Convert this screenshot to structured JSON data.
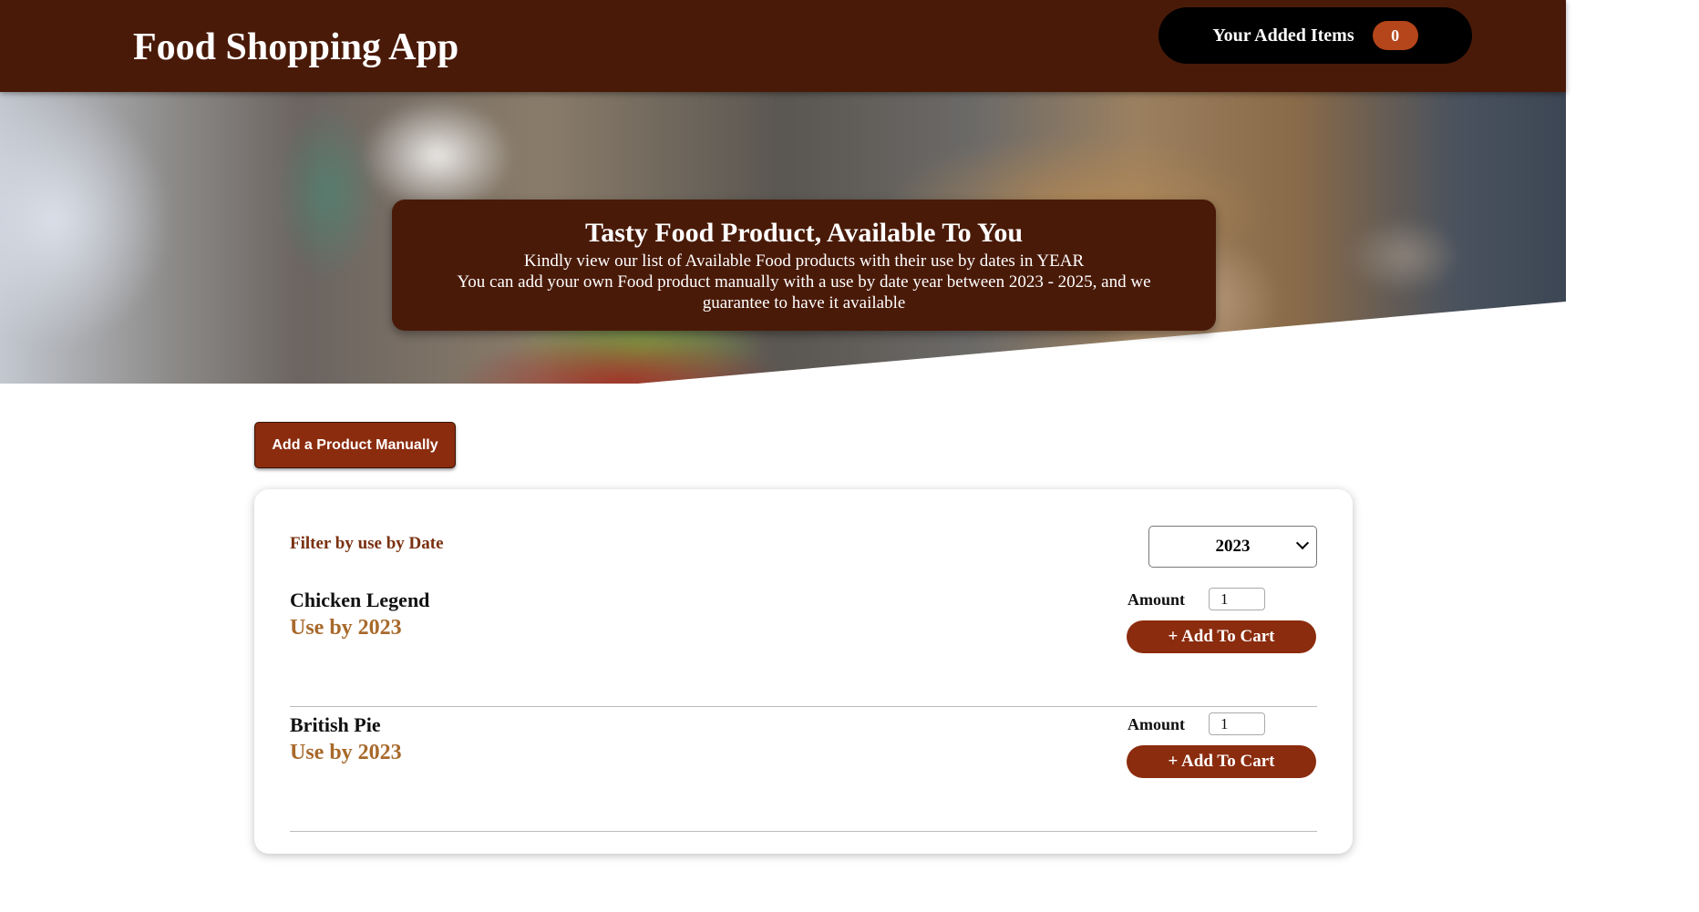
{
  "header": {
    "title": "Food Shopping App",
    "cart_label": "Your Added Items",
    "cart_count": "0"
  },
  "banner": {
    "title": "Tasty Food Product, Available To You",
    "line1": "Kindly view our list of Available Food products with their use by dates in YEAR",
    "line2": "You can add your own Food product manually with a use by date year between 2023 - 2025, and we guarantee to have it available"
  },
  "actions": {
    "add_product_label": "Add a Product Manually"
  },
  "filter": {
    "label": "Filter by use by Date",
    "selected_year": "2023"
  },
  "products": [
    {
      "name": "Chicken Legend",
      "use_by": "Use by 2023",
      "amount_label": "Amount",
      "amount": "1",
      "button_label": "+ Add To Cart"
    },
    {
      "name": "British Pie",
      "use_by": "Use by 2023",
      "amount_label": "Amount",
      "amount": "1",
      "button_label": "+ Add To Cart"
    }
  ],
  "colors": {
    "header_bg": "#4a1a08",
    "accent": "#8b2c0e",
    "use_by_text": "#a8692b",
    "badge": "#b5451b"
  }
}
